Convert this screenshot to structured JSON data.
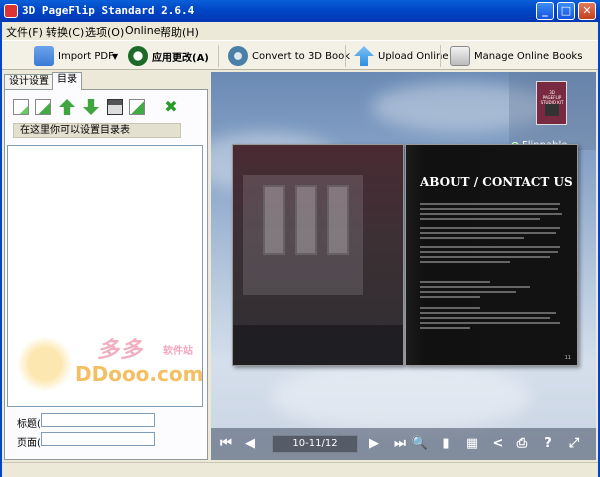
{
  "window": {
    "title": "3D PageFlip Standard 2.6.4",
    "minimize": "_",
    "maximize": "□",
    "close": "✕"
  },
  "menu": [
    "文件(F)",
    "转换(C)",
    "选项(O)",
    "Online",
    "帮助(H)"
  ],
  "toolbar": {
    "import_pdf": "Import PDF",
    "apply_changes": "应用更改(A)",
    "convert": "Convert to 3D Book",
    "upload": "Upload Online",
    "manage": "Manage Online Books",
    "colors": {
      "import": "#3b7bd6",
      "apply": "#1c6a2a",
      "convert": "#4a7fa8",
      "upload": "#2d8ee0",
      "manage": "#8a8a8a"
    }
  },
  "left_panel": {
    "tabs": [
      "设计设置",
      "目录"
    ],
    "active_tab": "目录",
    "icons": [
      "add-page-icon",
      "add-child-icon",
      "move-up-icon",
      "move-down-icon",
      "save-icon",
      "edit-icon",
      "delete-icon"
    ],
    "hint": "在这里你可以设置目录表",
    "title_label": "标题(",
    "page_label": "页面(",
    "watermark": {
      "cn": "多多",
      "cn2": "软件站",
      "en": "DDooo.com"
    }
  },
  "viewer": {
    "flippable_label": "Flippable",
    "thumbnail_text": "3D PAGEFLIP STUDIO KIT",
    "page_heading": "ABOUT / CONTACT US",
    "page_indicator": "10-11/12",
    "page_number": "11",
    "nav_icons": {
      "first": "⏮",
      "prev": "◀",
      "next": "▶",
      "last": "⏭",
      "zoom": "🔍",
      "bookmark": "▮",
      "thumbnails": "▦",
      "share": "<",
      "print": "⎙",
      "help": "?",
      "fullscreen": "⤢"
    }
  }
}
